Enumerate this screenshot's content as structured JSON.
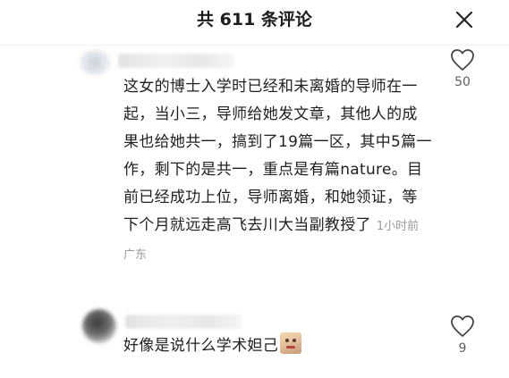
{
  "header": {
    "title": "共 611 条评论"
  },
  "comments": [
    {
      "text": "这女的博士入学时已经和未离婚的导师在一起，当小三，导师给她发文章，其他人的成果也给她共一，搞到了19篇一区，其中5篇一作，剩下的是共一，重点是有篇nature。目前已经成功上位，导师离婚，和她领证，等下个月就远走高飞去川大当副教授了",
      "time": "1小时前",
      "location": "广东",
      "likes": "50"
    },
    {
      "text": "好像是说什么学术妲己",
      "likes": "9"
    }
  ],
  "icons": {
    "close": "close-icon",
    "like": "heart-outline-icon",
    "emoji": "sticker-emoji-icon"
  },
  "colors": {
    "text": "#1f1f1f",
    "meta": "#9a9a9a",
    "count": "#5f5f5f"
  }
}
